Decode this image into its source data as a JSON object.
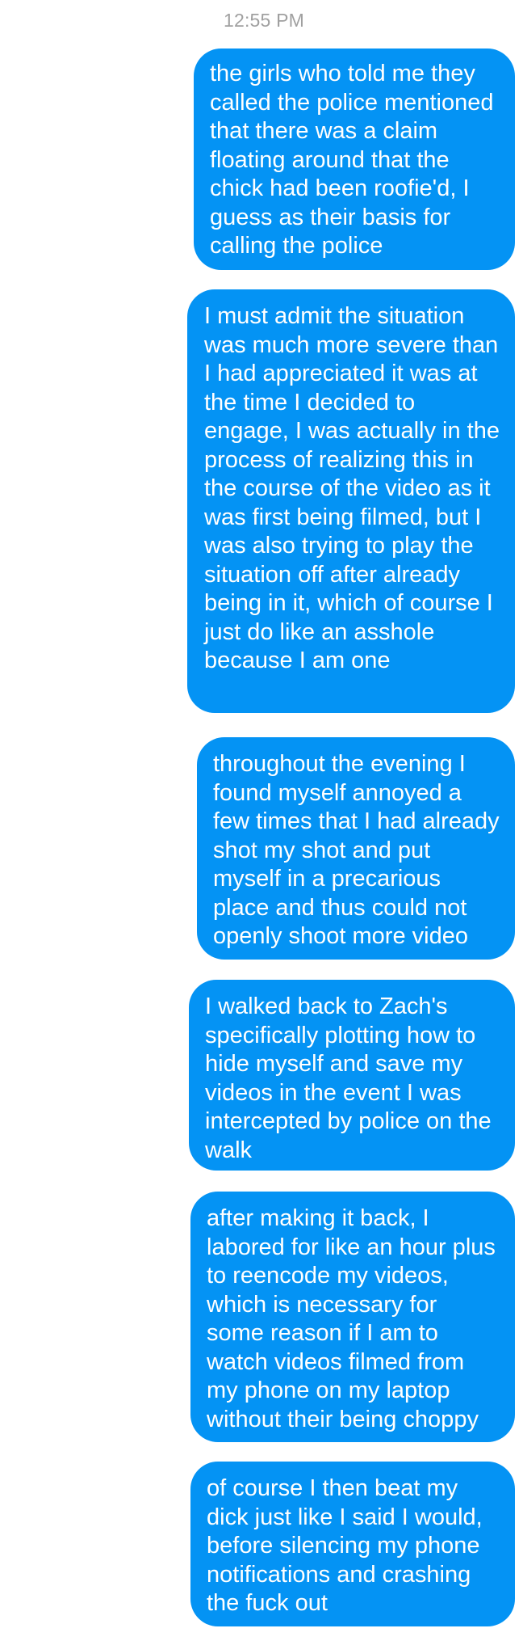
{
  "conversation": {
    "timestamp": "12:55 PM",
    "messages": [
      {
        "sender": "me",
        "text": "the girls who told me they called the police mentioned that there was a claim floating around that the chick had been roofie'd, I guess as their basis for calling the police"
      },
      {
        "sender": "me",
        "text": "I must admit the situation was much more severe than I had appreciated it was at the time I decided to engage, I was actually in the process of realizing this in the course of the video as it was first being filmed, but I was also trying to play the situation off after already being in it, which of course I just do like an asshole because I am one"
      },
      {
        "sender": "me",
        "text": "throughout the evening I found myself annoyed a few times that I had already shot my shot and put myself in a precarious place and thus could not openly shoot more video"
      },
      {
        "sender": "me",
        "text": "I walked back to Zach's specifically plotting how to hide myself and save my videos in the event I was intercepted by police on the walk"
      },
      {
        "sender": "me",
        "text": "after making it back, I labored for like an hour plus to reencode my videos, which is necessary for some reason if I am to watch videos filmed from my phone on my laptop without their being choppy"
      },
      {
        "sender": "me",
        "text": "of course I then beat my dick just like I said I would, before silencing my phone notifications and crashing the fuck out"
      }
    ]
  },
  "colors": {
    "bubble_background": "#0493f4",
    "bubble_text": "#ffffff",
    "timestamp_text": "#a0a0a0",
    "page_background": "#ffffff"
  }
}
